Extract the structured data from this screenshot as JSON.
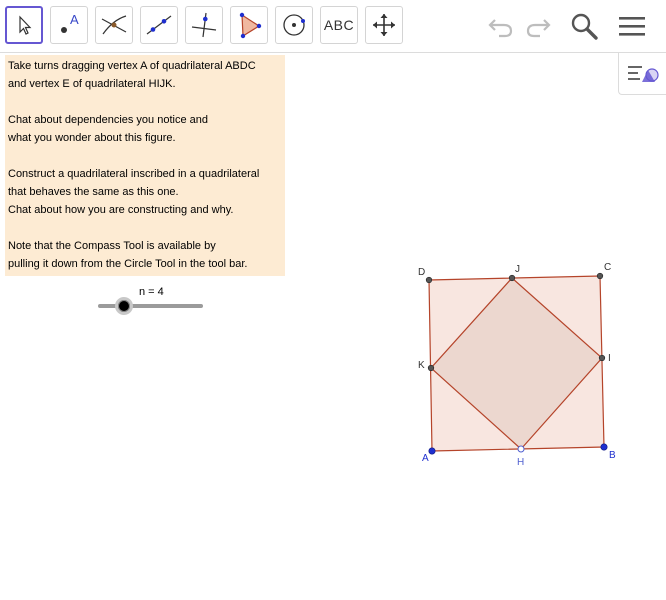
{
  "toolbar": {
    "tools": [
      {
        "name": "move-tool",
        "icon": "cursor-arrow-icon",
        "selected": true
      },
      {
        "name": "point-tool",
        "icon": "point-icon",
        "label": "A"
      },
      {
        "name": "intersect-tool",
        "icon": "intersect-icon"
      },
      {
        "name": "line-tool",
        "icon": "line-through-points-icon"
      },
      {
        "name": "perpendicular-tool",
        "icon": "perpendicular-line-icon"
      },
      {
        "name": "polygon-tool",
        "icon": "polygon-icon"
      },
      {
        "name": "circle-tool",
        "icon": "circle-center-point-icon"
      },
      {
        "name": "text-tool",
        "icon": "text-abc-icon",
        "label": "ABC"
      },
      {
        "name": "move-graphics-tool",
        "icon": "move-arrows-icon"
      }
    ],
    "right_icons": [
      "undo-icon",
      "redo-icon",
      "search-icon",
      "menu-icon"
    ]
  },
  "style_bar_icon": "style-bar-toggle-icon",
  "instructions": {
    "lines": [
      "Take turns dragging vertex A of quadrilateral ABDC",
      "and vertex E of quadrilateral HIJK.",
      "",
      "Chat about dependencies you notice and",
      "what you wonder about this figure.",
      "",
      "Construct a quadrilateral inscribed in a quadrilateral",
      "that behaves the same as this one.",
      "Chat about how you are constructing and why.",
      "",
      "Note that the Compass Tool is available by",
      "pulling it down from the Circle Tool in the tool bar."
    ]
  },
  "slider": {
    "label": "n = 4",
    "value": 4,
    "fraction": 0.25
  },
  "figure": {
    "labels": {
      "A": "A",
      "B": "B",
      "C": "C",
      "D": "D",
      "H": "H",
      "I": "I",
      "J": "J",
      "K": "K"
    },
    "colors": {
      "outer_fill": "#f8e6e0",
      "inner_fill": "#ecd7cf",
      "edge": "#b5442a",
      "free_point": "#1f2fcf",
      "dependent_point": "#444444",
      "label_h": "#5060d0"
    }
  }
}
